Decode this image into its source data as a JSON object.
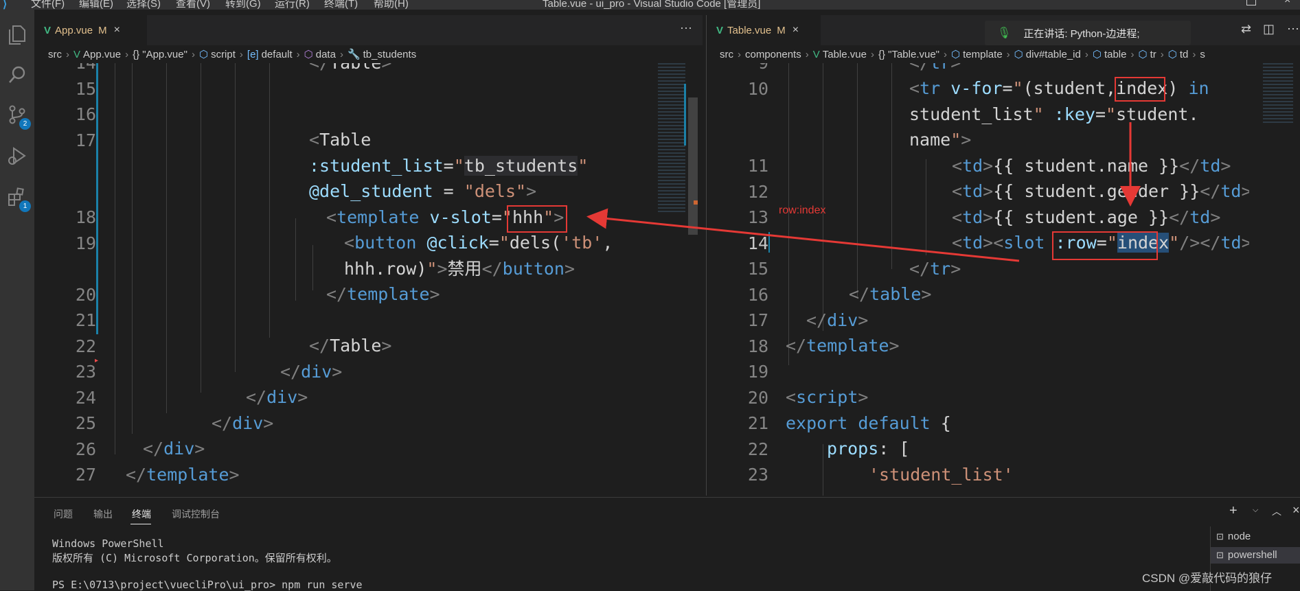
{
  "window": {
    "menu": [
      "文件(F)",
      "编辑(E)",
      "选择(S)",
      "查看(V)",
      "转到(G)",
      "运行(R)",
      "终端(T)",
      "帮助(H)"
    ],
    "title": "Table.vue - ui_pro - Visual Studio Code [管理员]"
  },
  "activity": {
    "scm_badge": "2",
    "ext_badge": "1"
  },
  "left_editor": {
    "tab": {
      "name": "App.vue",
      "status": "M",
      "close": "×"
    },
    "more": "···",
    "breadcrumb": [
      "src",
      "App.vue",
      "{} \"App.vue\"",
      "script",
      "default",
      "data",
      "tb_students"
    ],
    "line_numbers": [
      "14",
      "15",
      "16",
      "17",
      "",
      "",
      "18",
      "19",
      "",
      "20",
      "21",
      "22",
      "23",
      "24",
      "25",
      "26",
      "27"
    ]
  },
  "right_editor": {
    "tab": {
      "name": "Table.vue",
      "status": "M",
      "close": "×"
    },
    "breadcrumb": [
      "src",
      "components",
      "Table.vue",
      "{} \"Table.vue\"",
      "template",
      "div#table_id",
      "table",
      "tr",
      "td",
      "s"
    ],
    "line_numbers": [
      "9",
      "10",
      "",
      "",
      "11",
      "12",
      "13",
      "14",
      "15",
      "16",
      "17",
      "18",
      "19",
      "20",
      "21",
      "22",
      "23"
    ]
  },
  "voice": {
    "text": "正在讲话: Python-边进程;"
  },
  "annotation": {
    "label": "row:index"
  },
  "panel": {
    "tabs": [
      "问题",
      "输出",
      "终端",
      "调试控制台"
    ],
    "active_tab": "终端",
    "terminal_lines": [
      "Windows PowerShell",
      "版权所有 (C) Microsoft Corporation。保留所有权利。",
      "",
      "PS E:\\0713\\project\\vuecliPro\\ui_pro> npm run serve"
    ],
    "terminals": [
      "node",
      "powershell"
    ]
  },
  "watermark": "CSDN @爱敲代码的狼仔",
  "colors": {
    "accent": "#007acc",
    "annotation": "#e53935",
    "modified": "#e2c08d"
  }
}
